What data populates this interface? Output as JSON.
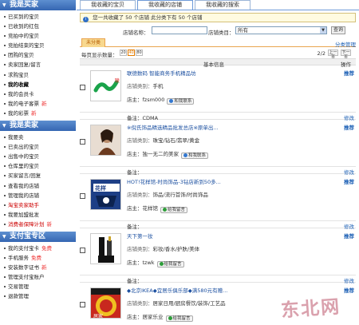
{
  "sidebar": {
    "buyer": {
      "title": "我是买家",
      "items": [
        {
          "label": "已买到的宝贝",
          "style": "normal"
        },
        {
          "label": "已收到的红包",
          "style": "normal"
        },
        {
          "label": "竞拍中的宝贝",
          "style": "normal"
        },
        {
          "label": "竞拍结束的宝贝",
          "style": "normal"
        },
        {
          "label": "团购的宝贝",
          "style": "normal"
        },
        {
          "label": "卖家回复/留言",
          "style": "normal"
        },
        {
          "label": "求购宝贝",
          "style": "normal"
        },
        {
          "label": "我的收藏",
          "style": "bold"
        },
        {
          "label": "我的会员卡",
          "style": "normal"
        },
        {
          "label": "我的电子客票",
          "style": "normal",
          "badge": "新"
        },
        {
          "label": "我的彩票",
          "style": "normal",
          "badge": "新"
        }
      ]
    },
    "seller": {
      "title": "我是卖家",
      "items": [
        {
          "label": "我要卖",
          "style": "normal"
        },
        {
          "label": "已卖出的宝贝",
          "style": "normal"
        },
        {
          "label": "出售中的宝贝",
          "style": "normal"
        },
        {
          "label": "仓库里的宝贝",
          "style": "normal"
        },
        {
          "label": "买家留言/回复",
          "style": "normal"
        },
        {
          "label": "查看我的店铺",
          "style": "normal"
        },
        {
          "label": "管理我的店铺",
          "style": "normal"
        },
        {
          "label": "淘宝卖家助手",
          "style": "red"
        },
        {
          "label": "我要加盟批发",
          "style": "normal"
        },
        {
          "label": "消费者保障计划",
          "style": "red",
          "badge": "新"
        }
      ]
    },
    "alipay": {
      "title": "支付宝专区",
      "items": [
        {
          "label": "我的支付宝卡",
          "style": "normal",
          "badge": "免费"
        },
        {
          "label": "手机服务",
          "style": "normal",
          "badge": "免费"
        },
        {
          "label": "安装数字证书",
          "style": "normal",
          "badge": "新"
        },
        {
          "label": "管理支付宝账户",
          "style": "normal"
        },
        {
          "label": "交易管理",
          "style": "normal"
        },
        {
          "label": "退款管理",
          "style": "normal"
        }
      ]
    }
  },
  "tabs": [
    "我收藏的宝贝",
    "我收藏的店铺",
    "我收藏的搜索"
  ],
  "notice": "您一共收藏了 50 个店铺 此分类下有 50 个店铺",
  "search": {
    "name_label": "店铺名称：",
    "name_value": "",
    "category_label": "店铺类目：",
    "category_value": "所有",
    "button": "查询"
  },
  "category_tab": "未分类",
  "category_manage": "分类管理",
  "pager": {
    "per_page_label": "每页显示数量：",
    "sizes": [
      "20",
      "40",
      "80"
    ],
    "active_size": "40",
    "page_indicator": "2/2",
    "prev": "上一页",
    "next": "下一页"
  },
  "table_header": {
    "info": "基本信息",
    "op": "操作"
  },
  "labels": {
    "category": "店铺类别：",
    "owner": "店主：",
    "note": "备注：",
    "recommend": "推荐",
    "edit": "修改"
  },
  "shops": [
    {
      "title": "联德数码 智能商务手机精品坊",
      "category": "手机",
      "owner": "fzsm000",
      "ww": "和我联系",
      "ww_state": "online",
      "note": "CDMA"
    },
    {
      "title": "※倪氏饰品精选精品批发总店※原单出...",
      "category": "珠宝/钻石/翡翠/黄金",
      "owner": "独一无二的美家",
      "ww": "和我联系",
      "ww_state": "online",
      "note": ""
    },
    {
      "title": "HOT!花样馆-时尚饰品-3钻店新到50多...",
      "category": "饰品/流行首饰/时尚饰品",
      "owner": "花样馆",
      "ww": "给我留言",
      "ww_state": "offline",
      "note": ""
    },
    {
      "title": "天下第一妆",
      "category": "彩妆/香水/护肤/美体",
      "owner": "tzwk",
      "ww": "给我留言",
      "ww_state": "offline",
      "note": ""
    },
    {
      "title": "◆北京IKEA◆宜居乐俱乐部◆满580元有赠...",
      "category": "居家日用/厨房餐饮/装饰/工艺品",
      "owner": "居家乐业",
      "ww": "给我留言",
      "ww_state": "offline",
      "note": ""
    }
  ],
  "watermark": "东北网",
  "colors": {
    "sidebar_header": "#3566b2",
    "link": "#1b5fb5",
    "accent_orange": "#e9a44e",
    "watermark": "#cd8291"
  }
}
